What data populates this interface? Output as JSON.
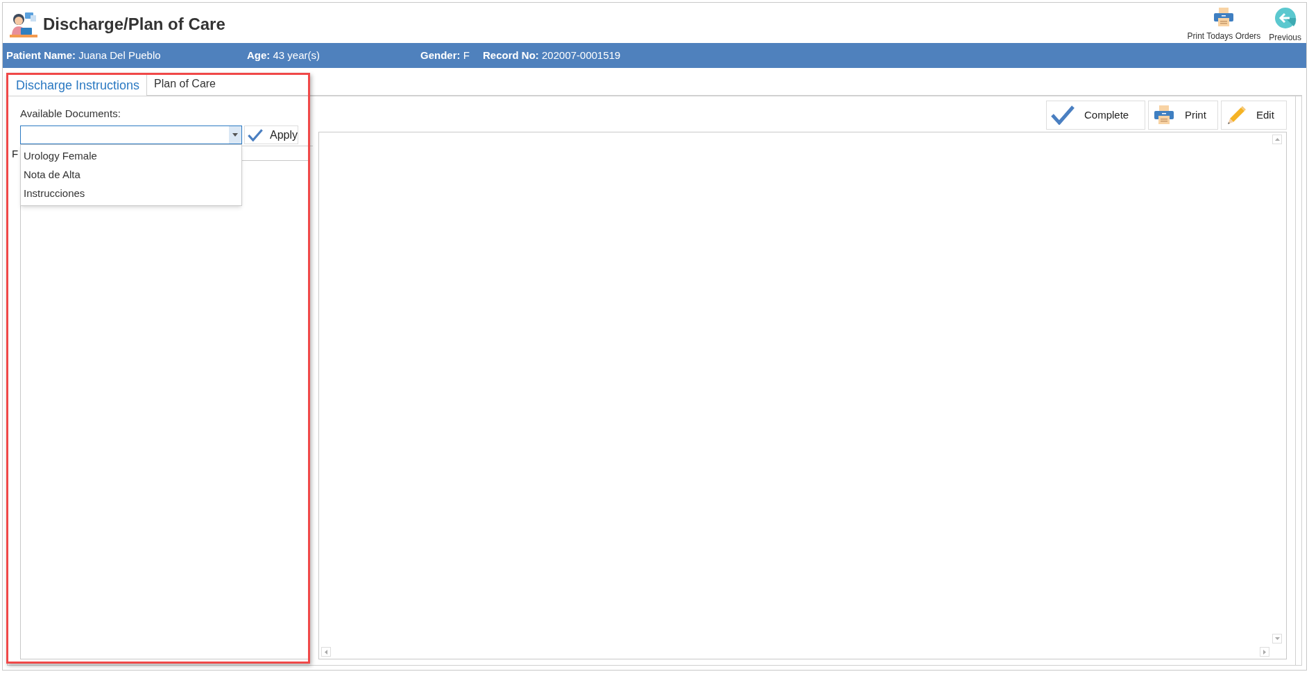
{
  "window": {
    "title": "Discharge/Plan of Care"
  },
  "toolbar": [
    {
      "label": "Print Todays Orders",
      "kind": "printer"
    },
    {
      "label": "Previous",
      "kind": "back"
    }
  ],
  "patient": [
    {
      "label": "Patient Name:",
      "value": "Juana Del Pueblo"
    },
    {
      "label": "Age:",
      "value": "43 year(s)"
    },
    {
      "label": "Gender:",
      "value": "F"
    },
    {
      "label": "Record No:",
      "value": "202007-0001519"
    }
  ],
  "tabs": [
    {
      "label": "Discharge Instructions",
      "selected": true
    },
    {
      "label": "Plan of Care",
      "selected": false
    }
  ],
  "documents": {
    "label": "Available Documents:",
    "expanded": true,
    "apply": "Apply",
    "hidden_label": "F",
    "options": [
      {
        "label": "Urology Female",
        "selected": false
      },
      {
        "label": "Nota de Alta",
        "selected": false
      },
      {
        "label": "Instrucciones",
        "selected": false
      }
    ]
  },
  "actions": [
    {
      "label": "Complete",
      "kind": "check"
    },
    {
      "label": "Print",
      "kind": "printer"
    },
    {
      "label": "Edit",
      "kind": "pencil"
    }
  ]
}
